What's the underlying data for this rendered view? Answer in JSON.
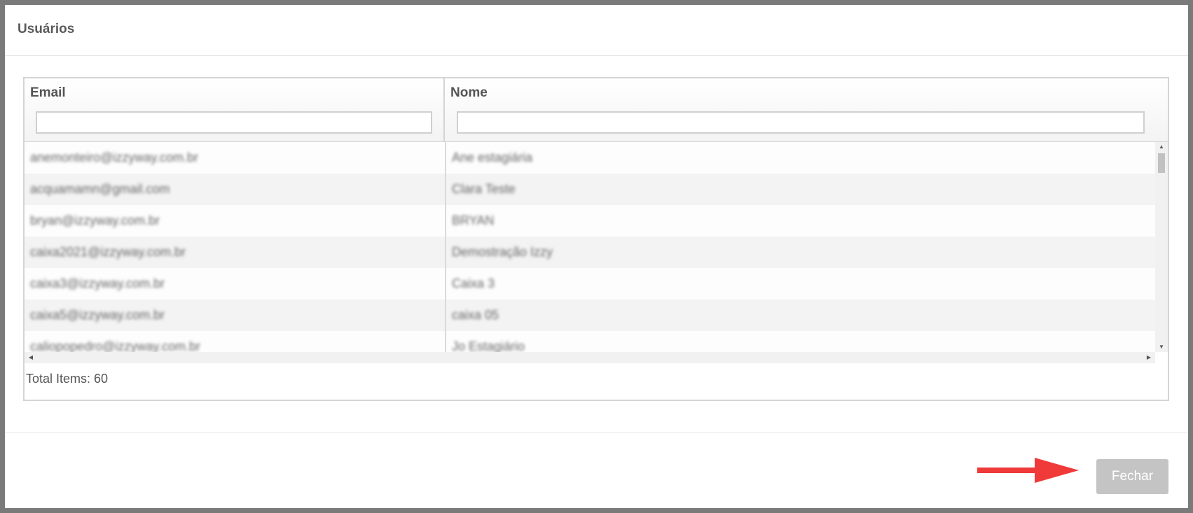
{
  "modal": {
    "title": "Usuários"
  },
  "grid": {
    "columns": [
      {
        "label": "Email",
        "filter_value": ""
      },
      {
        "label": "Nome",
        "filter_value": ""
      }
    ],
    "rows": [
      {
        "email": "anemonteiro@izzyway.com.br",
        "nome": "Ane estagiária"
      },
      {
        "email": "acquamamn@gmail.com",
        "nome": "Clara Teste"
      },
      {
        "email": "bryan@izzyway.com.br",
        "nome": "BRYAN"
      },
      {
        "email": "caixa2021@izzyway.com.br",
        "nome": "Demostração Izzy"
      },
      {
        "email": "caixa3@izzyway.com.br",
        "nome": "Caixa 3"
      },
      {
        "email": "caixa5@izzyway.com.br",
        "nome": "caixa 05"
      },
      {
        "email": "caliopopedro@izzyway.com.br",
        "nome": "Jo Estagiário"
      }
    ],
    "total_items": "Total Items: 60"
  },
  "footer": {
    "close_label": "Fechar"
  },
  "colors": {
    "annotation_arrow": "#f03a3a",
    "button_bg": "#c4c4c4",
    "backdrop": "#7a7a7a"
  },
  "icons": {
    "scroll_up": "caret-up-icon",
    "scroll_down": "caret-down-icon",
    "scroll_left": "caret-left-icon",
    "scroll_right": "caret-right-icon",
    "annotation": "red-arrow-icon"
  }
}
